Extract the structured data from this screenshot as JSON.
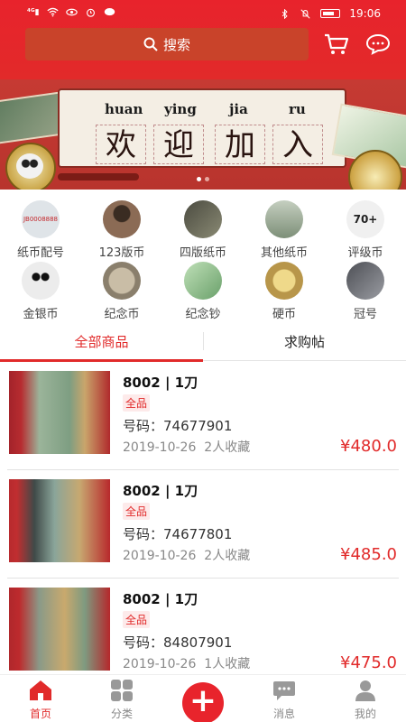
{
  "status_bar": {
    "time": "19:06",
    "signal": "4G"
  },
  "header": {
    "search_label": "搜索",
    "cart_icon": "cart-icon",
    "message_icon": "chat-bubble-icon"
  },
  "banner": {
    "pinyin": [
      "huan",
      "ying",
      "jia",
      "ru"
    ],
    "characters": [
      "欢",
      "迎",
      "加",
      "入"
    ],
    "slide_count": 2,
    "active_slide": 1
  },
  "categories": [
    {
      "label": "纸币配号",
      "thumb_text": "JB0008888",
      "color": "#dfe4e8"
    },
    {
      "label": "123版币",
      "color": "#8b6b55"
    },
    {
      "label": "四版纸币",
      "color": "#6b6b5c"
    },
    {
      "label": "其他纸币",
      "color": "#9aa792"
    },
    {
      "label": "评级币",
      "thumb_text": "70+",
      "color": "#3b3b3b"
    },
    {
      "label": "金银币",
      "color": "#e9e9e9"
    },
    {
      "label": "纪念币",
      "color": "#a89c87"
    },
    {
      "label": "纪念钞",
      "color": "#8fb58a"
    },
    {
      "label": "硬币",
      "color": "#d2bb7a"
    },
    {
      "label": "冠号",
      "color": "#6c6e74"
    }
  ],
  "tabs": [
    {
      "label": "全部商品",
      "active": true
    },
    {
      "label": "求购帖",
      "active": false
    }
  ],
  "products": [
    {
      "name": "8002 | 1刀",
      "tag": "全品",
      "code_label": "号码：",
      "code": "74677901",
      "date": "2019-10-26",
      "favorites": "2人收藏",
      "price": "¥480.0",
      "photo_color": "#b3262c"
    },
    {
      "name": "8002 | 1刀",
      "tag": "全品",
      "code_label": "号码：",
      "code": "74677801",
      "date": "2019-10-26",
      "favorites": "2人收藏",
      "price": "¥485.0",
      "photo_color": "#c02a2e"
    },
    {
      "name": "8002 | 1刀",
      "tag": "全品",
      "code_label": "号码：",
      "code": "84807901",
      "date": "2019-10-26",
      "favorites": "1人收藏",
      "price": "¥475.0",
      "photo_color": "#b92a2c"
    }
  ],
  "bottom_nav": [
    {
      "label": "首页",
      "icon": "home-icon",
      "active": true
    },
    {
      "label": "分类",
      "icon": "grid-icon",
      "active": false
    },
    {
      "label": "",
      "icon": "plus-icon",
      "active": false
    },
    {
      "label": "消息",
      "icon": "message-icon",
      "active": false
    },
    {
      "label": "我的",
      "icon": "user-icon",
      "active": false
    }
  ],
  "colors": {
    "brand_red": "#e12a2a",
    "header_red": "#e8232c"
  }
}
